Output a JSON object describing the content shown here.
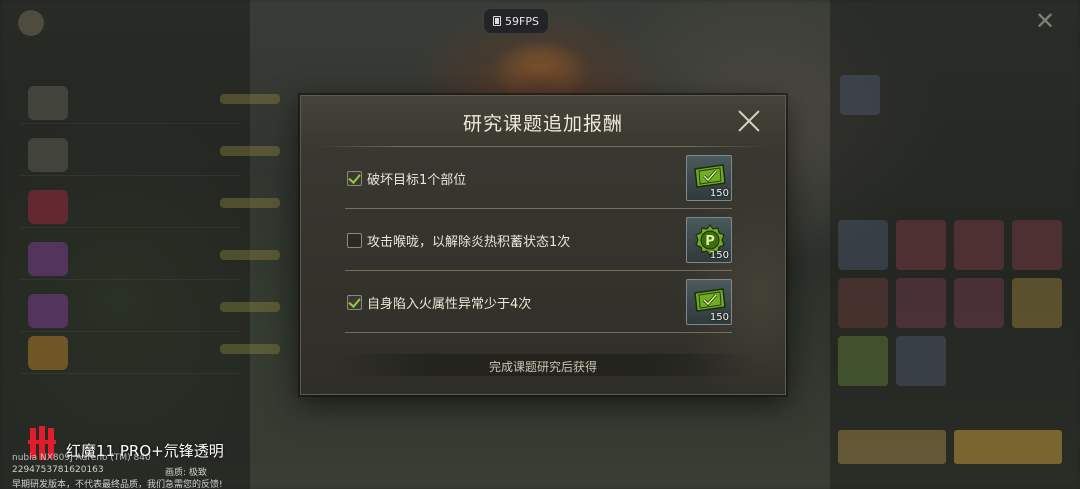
{
  "fps_counter": {
    "label": "59FPS"
  },
  "dialog": {
    "title": "研究课题追加报酬",
    "objectives": [
      {
        "text": "破坏目标1个部位",
        "checked": true,
        "reward_icon": "green-ticket-icon",
        "reward_qty": "150"
      },
      {
        "text": "攻击喉咙，以解除炎热积蓄状态1次",
        "checked": false,
        "reward_icon": "green-p-badge-icon",
        "reward_qty": "150"
      },
      {
        "text": "自身陷入火属性异常少于4次",
        "checked": true,
        "reward_icon": "green-ticket-icon",
        "reward_qty": "150"
      }
    ],
    "footer": "完成课题研究后获得"
  },
  "watermark": {
    "brand": "红魔11 PRO+氘锋透明",
    "gpu_info": "nubia NX809J Adreno (TM) 840",
    "serial": "2294753781620163",
    "quality": "画质: 极致",
    "disclaimer": "早期研发版本，不代表最终品质，我们急需您的反馈!"
  },
  "colors": {
    "accent_green": "#8fd13a",
    "dialog_bg": "#36352e",
    "text_primary": "#ebe6d8"
  }
}
